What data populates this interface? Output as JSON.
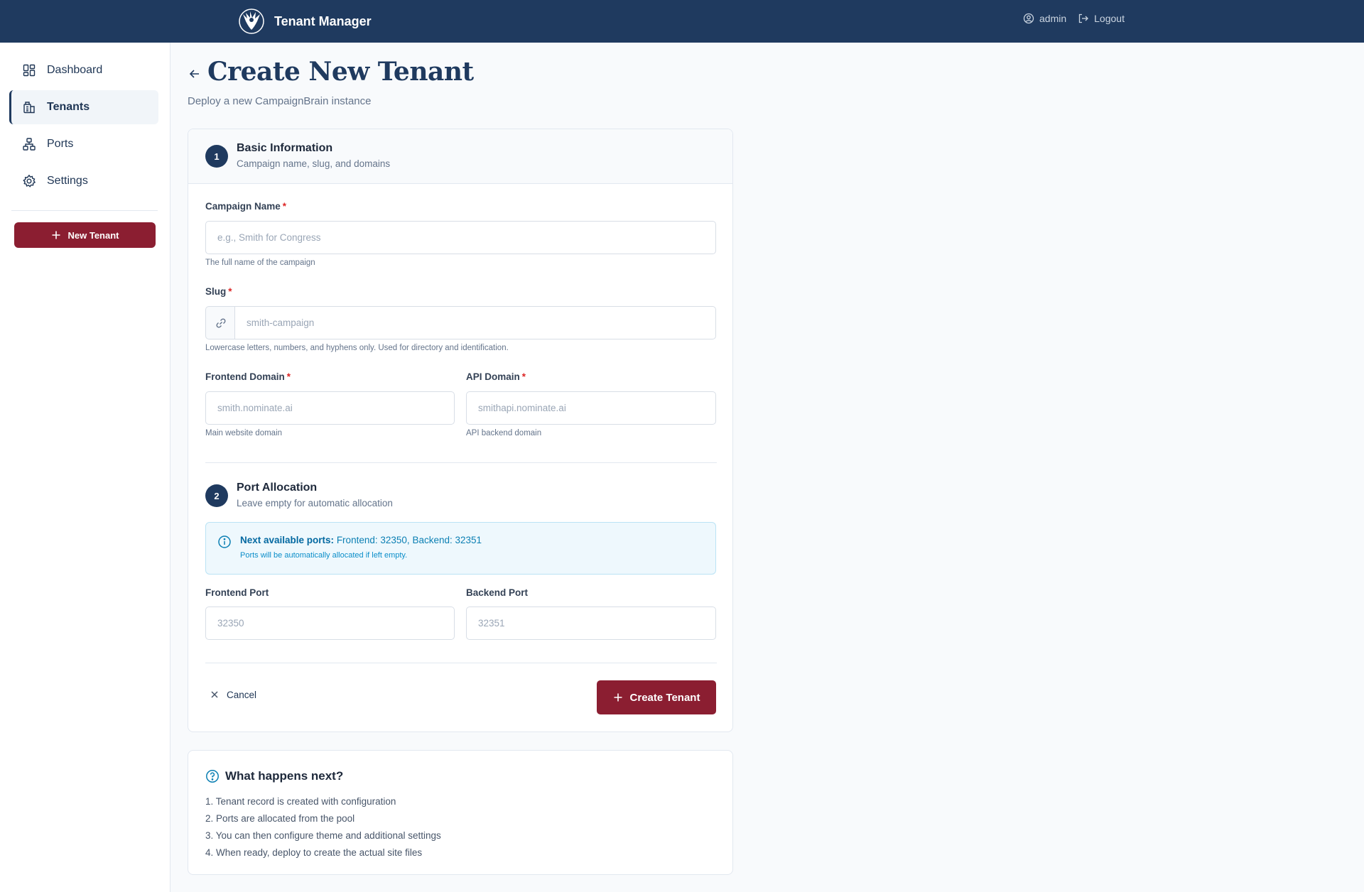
{
  "app": {
    "title": "Tenant Manager"
  },
  "topbar": {
    "user": "admin",
    "logout": "Logout"
  },
  "sidebar": {
    "items": [
      {
        "label": "Dashboard",
        "icon": "dashboard-icon"
      },
      {
        "label": "Tenants",
        "icon": "building-icon",
        "active": true
      },
      {
        "label": "Ports",
        "icon": "network-icon"
      },
      {
        "label": "Settings",
        "icon": "gear-icon"
      }
    ],
    "new_button": "New Tenant"
  },
  "page": {
    "title": "Create New Tenant",
    "subtitle": "Deploy a new CampaignBrain instance"
  },
  "section1": {
    "num": "1",
    "title": "Basic Information",
    "desc": "Campaign name, slug, and domains"
  },
  "fields": {
    "campaign_name": {
      "label": "Campaign Name",
      "placeholder": "e.g., Smith for Congress",
      "help": "The full name of the campaign",
      "value": ""
    },
    "slug": {
      "label": "Slug",
      "placeholder": "smith-campaign",
      "help": "Lowercase letters, numbers, and hyphens only. Used for directory and identification.",
      "value": ""
    },
    "frontend_domain": {
      "label": "Frontend Domain",
      "placeholder": "smith.nominate.ai",
      "help": "Main website domain",
      "value": ""
    },
    "api_domain": {
      "label": "API Domain",
      "placeholder": "smithapi.nominate.ai",
      "help": "API backend domain",
      "value": ""
    },
    "frontend_port": {
      "label": "Frontend Port",
      "placeholder": "32350",
      "value": ""
    },
    "backend_port": {
      "label": "Backend Port",
      "placeholder": "32351",
      "value": ""
    }
  },
  "required_marker": "*",
  "section2": {
    "num": "2",
    "title": "Port Allocation",
    "desc": "Leave empty for automatic allocation"
  },
  "info": {
    "heading": "Next available ports:",
    "frontend_label": "Frontend:",
    "frontend_port": "32350",
    "backend_label": "Backend:",
    "backend_port": "32351",
    "note": "Ports will be automatically allocated if left empty."
  },
  "actions": {
    "cancel": "Cancel",
    "create": "Create Tenant"
  },
  "next": {
    "title": "What happens next?",
    "steps": [
      "1. Tenant record is created with configuration",
      "2. Ports are allocated from the pool",
      "3. You can then configure theme and additional settings",
      "4. When ready, deploy to create the actual site files"
    ]
  },
  "colors": {
    "navy": "#1f3a5f",
    "brand_red": "#8b1e31",
    "info_blue": "#0b7fb3"
  }
}
